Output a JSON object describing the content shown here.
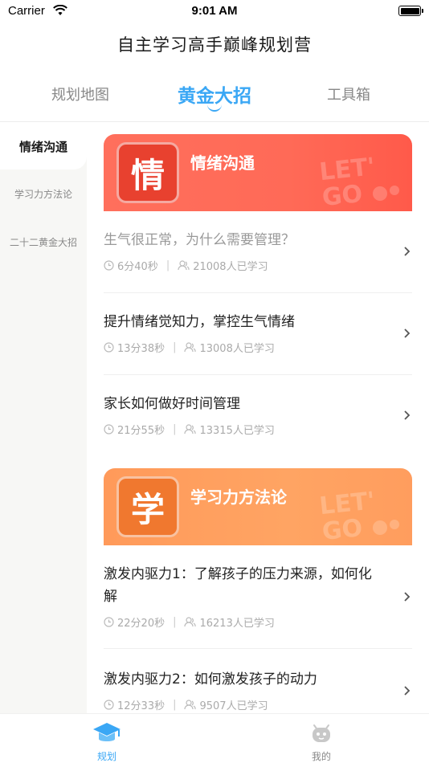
{
  "status_bar": {
    "carrier": "Carrier",
    "time": "9:01 AM"
  },
  "page_title": "自主学习高手巅峰规划营",
  "top_tabs": [
    {
      "label": "规划地图",
      "active": false
    },
    {
      "label": "黄金大招",
      "active": true
    },
    {
      "label": "工具箱",
      "active": false
    }
  ],
  "sidebar": {
    "items": [
      {
        "label": "情绪沟通",
        "active": true
      },
      {
        "label": "学习力方法论",
        "active": false
      },
      {
        "label": "二十二黄金大招",
        "active": false
      }
    ]
  },
  "sections": [
    {
      "badge": "情",
      "title": "情绪沟通",
      "decoration_text": "LET'S GO",
      "lessons": [
        {
          "title": "生气很正常，为什么需要管理？",
          "duration": "6分40秒",
          "learners": "21008人已学习",
          "viewed": true
        },
        {
          "title": "提升情绪觉知力，掌控生气情绪",
          "duration": "13分38秒",
          "learners": "13008人已学习",
          "viewed": false
        },
        {
          "title": "家长如何做好时间管理",
          "duration": "21分55秒",
          "learners": "13315人已学习",
          "viewed": false
        }
      ]
    },
    {
      "badge": "学",
      "title": "学习力方法论",
      "decoration_text": "LET'S GO",
      "lessons": [
        {
          "title": "激发内驱力1：了解孩子的压力来源，如何化解",
          "duration": "22分20秒",
          "learners": "16213人已学习",
          "viewed": false
        },
        {
          "title": "激发内驱力2：如何激发孩子的动力",
          "duration": "12分33秒",
          "learners": "9507人已学习",
          "viewed": false
        }
      ]
    }
  ],
  "bottom_nav": [
    {
      "label": "规划",
      "icon": "graduation-cap-icon",
      "active": true
    },
    {
      "label": "我的",
      "icon": "robot-face-icon",
      "active": false
    }
  ],
  "colors": {
    "accent_blue": "#3aa7f5",
    "banner_red": "#ff6f5c",
    "banner_orange": "#ffa463",
    "badge_red": "#e8412f",
    "badge_orange": "#f0782f"
  }
}
